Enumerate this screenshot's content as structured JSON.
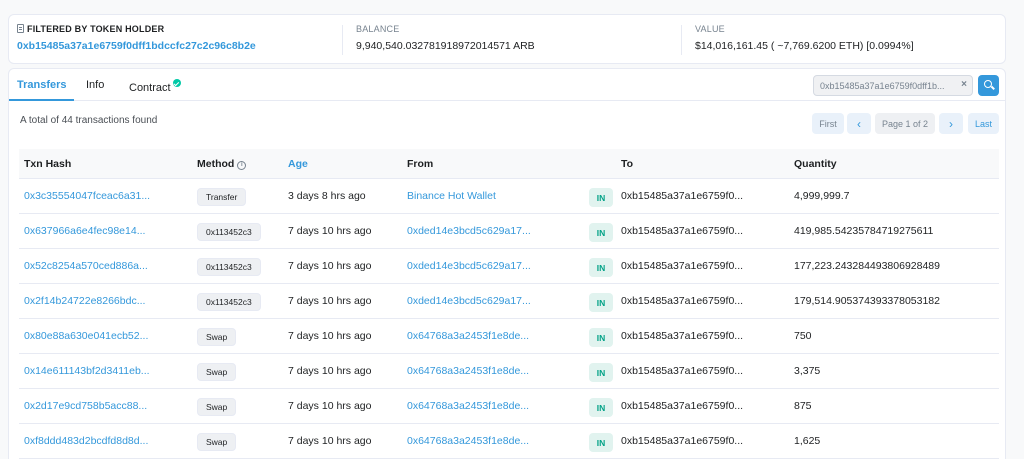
{
  "filter": {
    "label": "FILTERED BY TOKEN HOLDER",
    "address": "0xb15485a37a1e6759f0dff1bdccfc27c2c96c8b2e",
    "balance_label": "BALANCE",
    "balance_value": "9,940,540.032781918972014571 ARB",
    "value_label": "VALUE",
    "value_value": "$14,016,161.45 ( ~7,769.6200 ETH) [0.0994%]"
  },
  "tabs": [
    {
      "label": "Transfers",
      "active": true
    },
    {
      "label": "Info",
      "active": false
    },
    {
      "label": "Contract",
      "active": false
    }
  ],
  "search": {
    "value": "0xb15485a37a1e6759f0dff1b...",
    "clear": "×"
  },
  "summary": "A total of 44 transactions found",
  "pager": {
    "first": "First",
    "prev": "‹",
    "page_info": "Page 1 of 2",
    "next": "›",
    "last": "Last"
  },
  "table": {
    "headers": {
      "hash": "Txn Hash",
      "method": "Method",
      "method_info": "i",
      "age": "Age",
      "from": "From",
      "to": "To",
      "quantity": "Quantity"
    },
    "rows": [
      {
        "hash": "0x3c35554047fceac6a31...",
        "method": "Transfer",
        "age": "3 days 8 hrs ago",
        "from": "Binance Hot Wallet",
        "direction": "IN",
        "to": "0xb15485a37a1e6759f0...",
        "quantity": "4,999,999.7"
      },
      {
        "hash": "0x637966a6e4fec98e14...",
        "method": "0x113452c3",
        "age": "7 days 10 hrs ago",
        "from": "0xded14e3bcd5c629a17...",
        "direction": "IN",
        "to": "0xb15485a37a1e6759f0...",
        "quantity": "419,985.54235784719275611"
      },
      {
        "hash": "0x52c8254a570ced886a...",
        "method": "0x113452c3",
        "age": "7 days 10 hrs ago",
        "from": "0xded14e3bcd5c629a17...",
        "direction": "IN",
        "to": "0xb15485a37a1e6759f0...",
        "quantity": "177,223.243284493806928489"
      },
      {
        "hash": "0x2f14b24722e8266bdc...",
        "method": "0x113452c3",
        "age": "7 days 10 hrs ago",
        "from": "0xded14e3bcd5c629a17...",
        "direction": "IN",
        "to": "0xb15485a37a1e6759f0...",
        "quantity": "179,514.905374393378053182"
      },
      {
        "hash": "0x80e88a630e041ecb52...",
        "method": "Swap",
        "age": "7 days 10 hrs ago",
        "from": "0x64768a3a2453f1e8de...",
        "direction": "IN",
        "to": "0xb15485a37a1e6759f0...",
        "quantity": "750"
      },
      {
        "hash": "0x14e611143bf2d3411eb...",
        "method": "Swap",
        "age": "7 days 10 hrs ago",
        "from": "0x64768a3a2453f1e8de...",
        "direction": "IN",
        "to": "0xb15485a37a1e6759f0...",
        "quantity": "3,375"
      },
      {
        "hash": "0x2d17e9cd758b5acc88...",
        "method": "Swap",
        "age": "7 days 10 hrs ago",
        "from": "0x64768a3a2453f1e8de...",
        "direction": "IN",
        "to": "0xb15485a37a1e6759f0...",
        "quantity": "875"
      },
      {
        "hash": "0xf8ddd483d2bcdfd8d8d...",
        "method": "Swap",
        "age": "7 days 10 hrs ago",
        "from": "0x64768a3a2453f1e8de...",
        "direction": "IN",
        "to": "0xb15485a37a1e6759f0...",
        "quantity": "1,625"
      }
    ]
  },
  "colors": {
    "accent": "#3498db",
    "in_badge": "#00a186",
    "verified": "#00c9a7"
  }
}
